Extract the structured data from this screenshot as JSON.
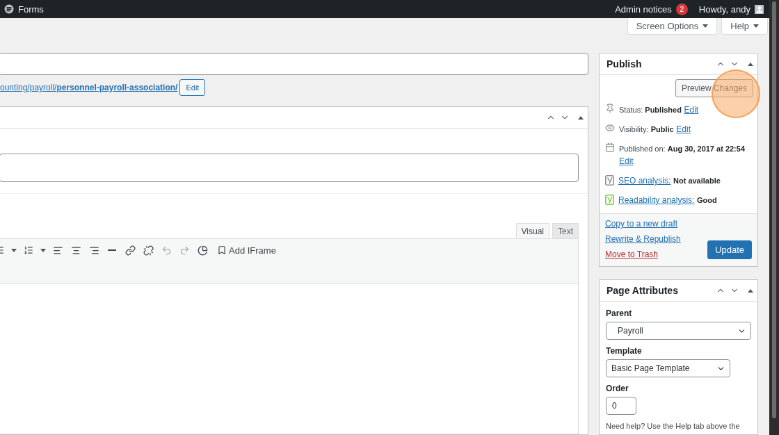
{
  "admin_bar": {
    "site_title": "Forms",
    "notices_label": "Admin notices",
    "notices_count": "2",
    "greeting": "Howdy, andy"
  },
  "screen_meta_buttons": [
    {
      "label": "Screen Options"
    },
    {
      "label": "Help"
    }
  ],
  "permalink": {
    "path": "ounting/payroll/",
    "slug": "personnel-payroll-association/",
    "edit_button": "Edit"
  },
  "editor": {
    "tabs": [
      {
        "label": "Visual",
        "selected": true
      },
      {
        "label": "Text",
        "selected": false
      }
    ],
    "toolbar": [
      {
        "kind": "bullet-list",
        "disabled": false
      },
      {
        "kind": "caret",
        "disabled": false
      },
      {
        "kind": "numbered-list",
        "disabled": false
      },
      {
        "kind": "caret",
        "disabled": false
      },
      {
        "kind": "align-left",
        "disabled": false
      },
      {
        "kind": "align-center",
        "disabled": false
      },
      {
        "kind": "align-right",
        "disabled": false
      },
      {
        "kind": "rule",
        "disabled": false
      },
      {
        "kind": "link",
        "disabled": false
      },
      {
        "kind": "unlink",
        "disabled": false
      },
      {
        "kind": "undo",
        "disabled": true
      },
      {
        "kind": "redo",
        "disabled": true
      },
      {
        "kind": "pie",
        "disabled": false
      }
    ],
    "add_iframe": "Add IFrame"
  },
  "publish": {
    "title": "Publish",
    "preview_button": "Preview Changes",
    "rows": [
      {
        "kind": "status",
        "label": "Status:",
        "value": "Published",
        "edit": "Edit"
      },
      {
        "kind": "visibility",
        "label": "Visibility:",
        "value": "Public",
        "edit": "Edit"
      },
      {
        "kind": "date",
        "label": "Published on:",
        "value": "Aug 30, 2017 at 22:54",
        "edit": "Edit"
      }
    ],
    "analyses": [
      {
        "link": "SEO analysis:",
        "value": "Not available",
        "color": "#8c8f94"
      },
      {
        "link": "Readability analysis:",
        "value": "Good",
        "color": "#7ad03a"
      }
    ],
    "actions": [
      {
        "kind": "link",
        "label": "Copy to a new draft"
      },
      {
        "kind": "link",
        "label": "Rewrite & Republish"
      },
      {
        "kind": "delete",
        "label": "Move to Trash"
      }
    ],
    "update_button": "Update"
  },
  "page_attributes": {
    "title": "Page Attributes",
    "parent": {
      "label": "Parent",
      "value": "Payroll"
    },
    "template": {
      "label": "Template",
      "value": "Basic Page Template"
    },
    "order": {
      "label": "Order",
      "value": "0"
    },
    "help": "Need help? Use the Help tab above the"
  }
}
